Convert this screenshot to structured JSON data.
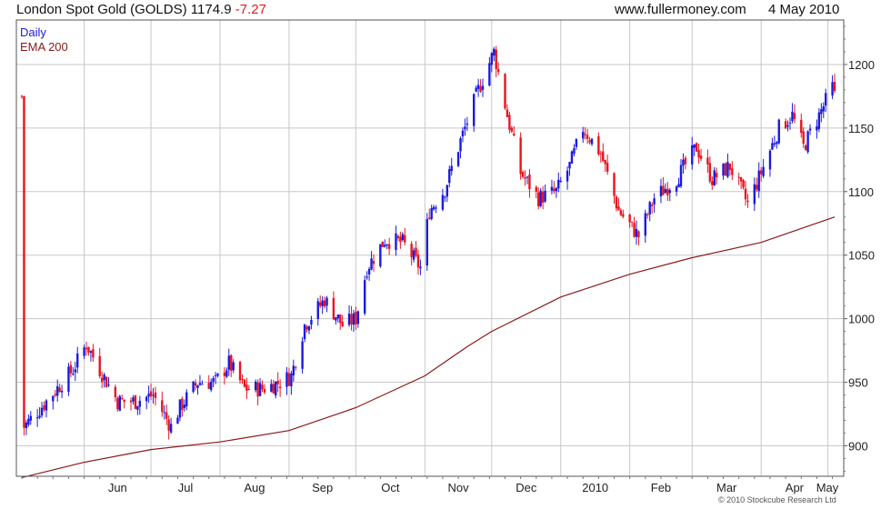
{
  "header": {
    "instrument": "London Spot Gold (GOLDS)",
    "last": "1174.9",
    "change": "-7.27",
    "site": "www.fullermoney.com",
    "date": "4 May 2010"
  },
  "footer": {
    "copyright": "© 2010 Stockcube Research Ltd"
  },
  "colors": {
    "up": "#1a1ae0",
    "down": "#e8141e",
    "ema": "#8b1a1a",
    "grid": "#c8c8c8"
  },
  "chart_data": {
    "type": "candlestick",
    "legend": [
      {
        "label": "Daily",
        "color": "#1a1ae0"
      },
      {
        "label": "EMA 200",
        "color": "#8b1a1a"
      }
    ],
    "legend_position": "top-left",
    "y_axis": {
      "side": "right",
      "ylim": [
        876,
        1235
      ],
      "ticks": [
        900,
        950,
        1000,
        1050,
        1100,
        1150,
        1200
      ]
    },
    "x_axis": {
      "labels": [
        "Jun",
        "Jul",
        "Aug",
        "Sep",
        "Oct",
        "Nov",
        "Dec",
        "2010",
        "Feb",
        "Mar",
        "Apr",
        "May"
      ]
    },
    "grid": true,
    "price_path": [
      [
        "2009-05-05",
        915
      ],
      [
        "2009-05-15",
        935
      ],
      [
        "2009-05-27",
        960
      ],
      [
        "2009-06-02",
        980
      ],
      [
        "2009-06-08",
        960
      ],
      [
        "2009-06-16",
        935
      ],
      [
        "2009-06-24",
        935
      ],
      [
        "2009-07-02",
        940
      ],
      [
        "2009-07-10",
        915
      ],
      [
        "2009-07-14",
        930
      ],
      [
        "2009-07-22",
        950
      ],
      [
        "2009-07-30",
        950
      ],
      [
        "2009-08-05",
        965
      ],
      [
        "2009-08-12",
        945
      ],
      [
        "2009-08-20",
        945
      ],
      [
        "2009-08-28",
        950
      ],
      [
        "2009-09-02",
        955
      ],
      [
        "2009-09-08",
        995
      ],
      [
        "2009-09-17",
        1015
      ],
      [
        "2009-09-25",
        995
      ],
      [
        "2009-10-01",
        1000
      ],
      [
        "2009-10-06",
        1040
      ],
      [
        "2009-10-14",
        1062
      ],
      [
        "2009-10-22",
        1060
      ],
      [
        "2009-10-30",
        1040
      ],
      [
        "2009-11-03",
        1085
      ],
      [
        "2009-11-10",
        1102
      ],
      [
        "2009-11-17",
        1140
      ],
      [
        "2009-11-25",
        1180
      ],
      [
        "2009-12-02",
        1210
      ],
      [
        "2009-12-08",
        1160
      ],
      [
        "2009-12-14",
        1115
      ],
      [
        "2009-12-22",
        1095
      ],
      [
        "2009-12-30",
        1100
      ],
      [
        "2010-01-05",
        1120
      ],
      [
        "2010-01-11",
        1150
      ],
      [
        "2010-01-19",
        1130
      ],
      [
        "2010-01-27",
        1085
      ],
      [
        "2010-02-05",
        1065
      ],
      [
        "2010-02-12",
        1095
      ],
      [
        "2010-02-22",
        1110
      ],
      [
        "2010-03-03",
        1135
      ],
      [
        "2010-03-10",
        1110
      ],
      [
        "2010-03-18",
        1120
      ],
      [
        "2010-03-26",
        1090
      ],
      [
        "2010-04-01",
        1115
      ],
      [
        "2010-04-09",
        1150
      ],
      [
        "2010-04-15",
        1160
      ],
      [
        "2010-04-20",
        1135
      ],
      [
        "2010-04-27",
        1160
      ],
      [
        "2010-05-03",
        1182
      ],
      [
        "2010-05-04",
        1175
      ]
    ],
    "ema_200_path": [
      [
        "2009-05-04",
        875
      ],
      [
        "2009-06-01",
        887
      ],
      [
        "2009-07-01",
        897
      ],
      [
        "2009-08-01",
        903
      ],
      [
        "2009-09-01",
        912
      ],
      [
        "2009-10-01",
        930
      ],
      [
        "2009-11-01",
        955
      ],
      [
        "2009-11-20",
        978
      ],
      [
        "2009-12-01",
        990
      ],
      [
        "2010-01-01",
        1017
      ],
      [
        "2010-02-01",
        1035
      ],
      [
        "2010-03-01",
        1048
      ],
      [
        "2010-04-01",
        1060
      ],
      [
        "2010-05-04",
        1080
      ]
    ]
  }
}
